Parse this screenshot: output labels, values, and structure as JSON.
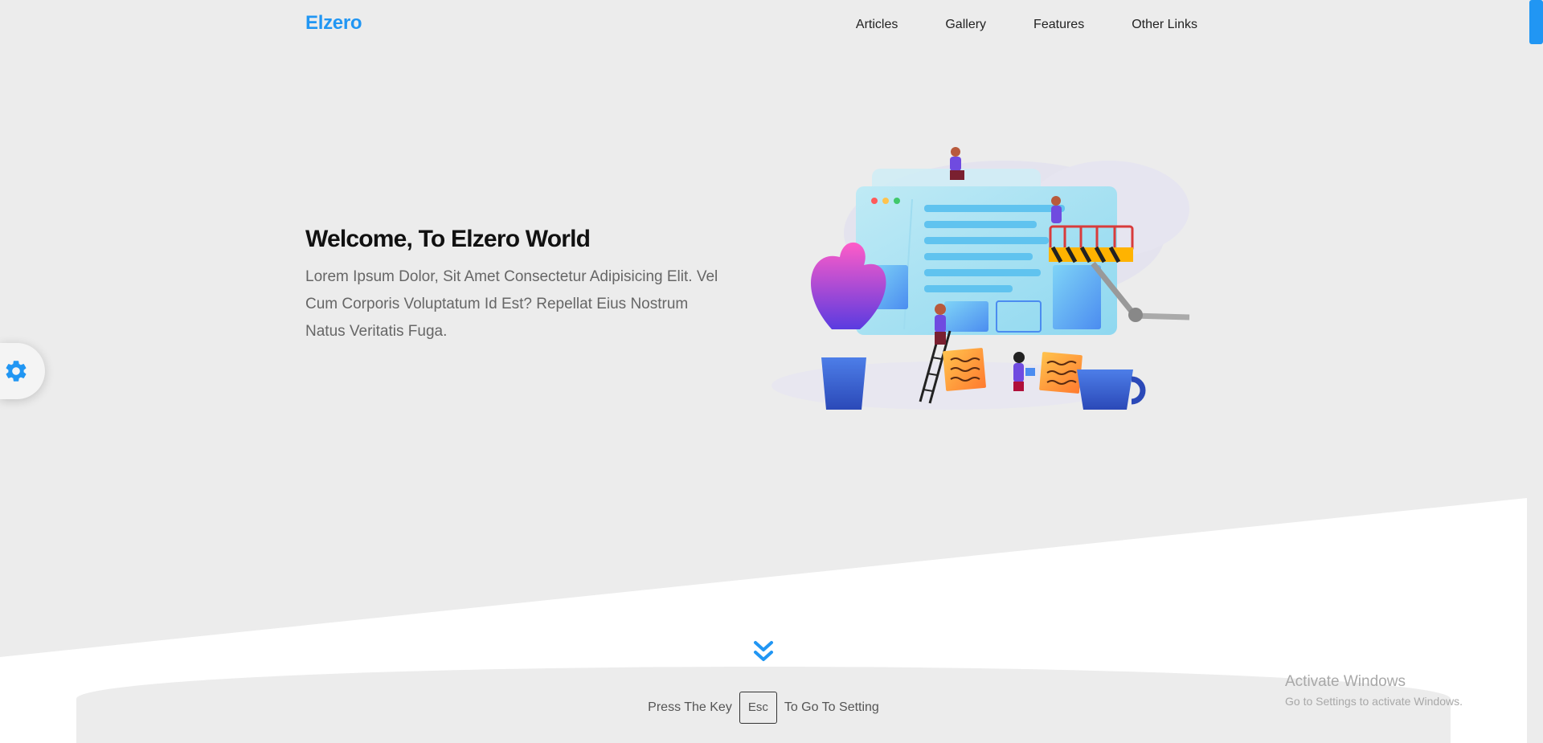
{
  "header": {
    "logo": "Elzero",
    "nav": [
      "Articles",
      "Gallery",
      "Features",
      "Other Links"
    ]
  },
  "hero": {
    "title": "Welcome, To Elzero World",
    "description": "Lorem Ipsum Dolor, Sit Amet Consectetur Adipisicing Elit. Vel Cum Corporis Voluptatum Id Est? Repellat Eius Nostrum Natus Veritatis Fuga."
  },
  "settings": {
    "icon": "gear-icon"
  },
  "footer_hint": {
    "before": "Press The Key",
    "key": "Esc",
    "after": "To Go To Setting"
  },
  "watermark": {
    "title": "Activate Windows",
    "subtitle": "Go to Settings to activate Windows."
  },
  "colors": {
    "accent": "#2196f3",
    "background": "#ececec",
    "text": "#111111",
    "muted": "#666666"
  }
}
